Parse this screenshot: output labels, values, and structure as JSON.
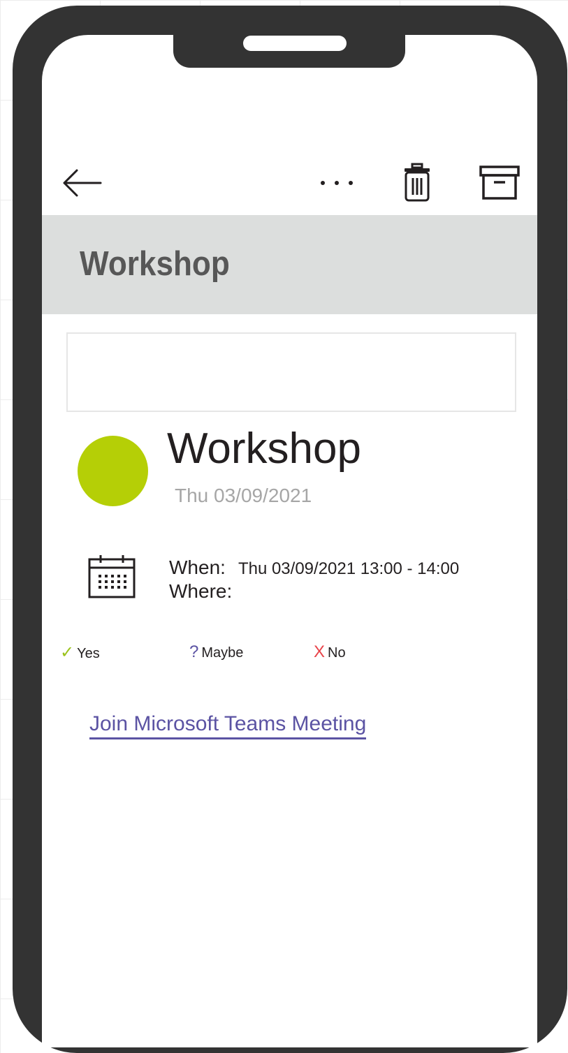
{
  "toolbar": {
    "back_icon": "arrow-left-icon",
    "more_icon": "more-horizontal-icon",
    "delete_icon": "trash-icon",
    "archive_icon": "archive-icon"
  },
  "header": {
    "title": "Workshop"
  },
  "event": {
    "avatar_color": "#b5cf06",
    "title": "Workshop",
    "date": "Thu 03/09/2021",
    "when_label": "When:",
    "when_value": "Thu 03/09/2021  13:00 - 14:00",
    "where_label": "Where:",
    "where_value": ""
  },
  "rsvp": {
    "yes": {
      "symbol": "✓",
      "label": "Yes",
      "color": "#9bc31c"
    },
    "maybe": {
      "symbol": "?",
      "label": "Maybe",
      "color": "#5b53a3"
    },
    "no": {
      "symbol": "X",
      "label": "No",
      "color": "#e8444a"
    }
  },
  "link": {
    "label": "Join Microsoft Teams Meeting",
    "color": "#5b53a3"
  }
}
